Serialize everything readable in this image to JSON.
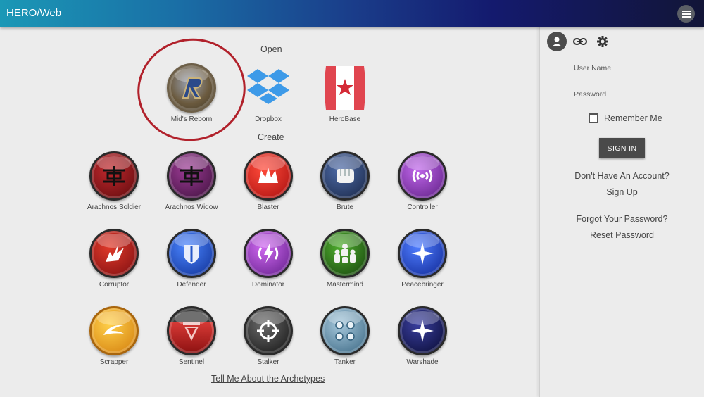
{
  "app": {
    "title": "HERO/Web"
  },
  "main": {
    "open_label": "Open",
    "create_label": "Create",
    "open_items": [
      {
        "label": "Mid's Reborn",
        "icon": "mids-reborn-icon"
      },
      {
        "label": "Dropbox",
        "icon": "dropbox-icon"
      },
      {
        "label": "HeroBase",
        "icon": "herobase-icon"
      }
    ],
    "archetypes": [
      {
        "label": "Arachnos Soldier",
        "color": "#8b0f12"
      },
      {
        "label": "Arachnos Widow",
        "color": "#5d1e5a"
      },
      {
        "label": "Blaster",
        "color": "#d11c1c"
      },
      {
        "label": "Brute",
        "color": "#2c3f6b"
      },
      {
        "label": "Controller",
        "color": "#8a34b8"
      },
      {
        "label": "Corruptor",
        "color": "#b3141a"
      },
      {
        "label": "Defender",
        "color": "#1d4fd1"
      },
      {
        "label": "Dominator",
        "color": "#9a2fbf"
      },
      {
        "label": "Mastermind",
        "color": "#2f7d1e"
      },
      {
        "label": "Peacebringer",
        "color": "#1f49c8"
      },
      {
        "label": "Scrapper",
        "color": "#f0a020"
      },
      {
        "label": "Sentinel",
        "color": "#bc2a2a"
      },
      {
        "label": "Stalker",
        "color": "#2a2a2a"
      },
      {
        "label": "Tanker",
        "color": "#6f99b5"
      },
      {
        "label": "Warshade",
        "color": "#141a60"
      }
    ],
    "footer_link": "Tell Me About the Archetypes"
  },
  "sidebar": {
    "username_placeholder": "User Name",
    "password_placeholder": "Password",
    "remember_label": "Remember Me",
    "signin_label": "SIGN IN",
    "no_account_text": "Don't Have An Account?",
    "signup_link": "Sign Up",
    "forgot_text": "Forgot Your Password?",
    "reset_link": "Reset Password"
  }
}
